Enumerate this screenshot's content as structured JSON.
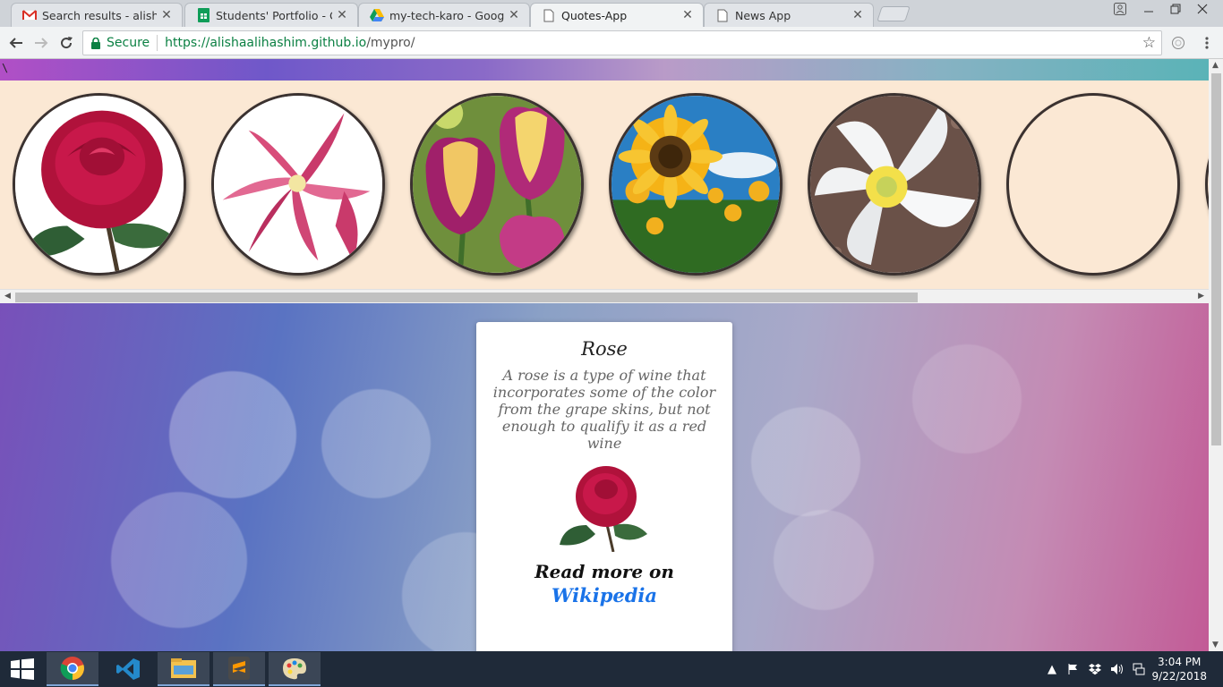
{
  "browser": {
    "tabs": [
      {
        "title": "Search results - alishaalih",
        "icon": "gmail-icon",
        "active": false
      },
      {
        "title": "Students' Portfolio - Goo",
        "icon": "sheets-icon",
        "active": false
      },
      {
        "title": "my-tech-karo - Google D",
        "icon": "drive-icon",
        "active": false
      },
      {
        "title": "Quotes-App",
        "icon": "page-icon",
        "active": true
      },
      {
        "title": "News App",
        "icon": "page-icon",
        "active": false
      }
    ],
    "close_glyph": "✕",
    "address": {
      "secure_label": "Secure",
      "url_host": "https://alishaalihashim.github.io",
      "url_path": "/mypro/"
    }
  },
  "page": {
    "stray_text": "\\",
    "gallery": [
      {
        "name": "rose"
      },
      {
        "name": "lily"
      },
      {
        "name": "tulip"
      },
      {
        "name": "sunflower"
      },
      {
        "name": "anemone"
      },
      {
        "name": "empty"
      }
    ],
    "card": {
      "title": "Rose",
      "description": "A rose is a type of wine that incorporates some of the color from the grape skins, but not enough to qualify it as a red wine",
      "read_more": "Read more on",
      "link_label": "Wikipedia"
    }
  },
  "taskbar": {
    "apps": [
      "windows-start-icon",
      "chrome-icon",
      "vscode-icon",
      "file-explorer-icon",
      "sublime-icon",
      "paint-icon"
    ],
    "time": "3:04 PM",
    "date": "9/22/2018"
  },
  "colors": {
    "gallery_bg": "#fbe8d4",
    "secure_green": "#0b8043",
    "link_blue": "#1a73e8"
  }
}
